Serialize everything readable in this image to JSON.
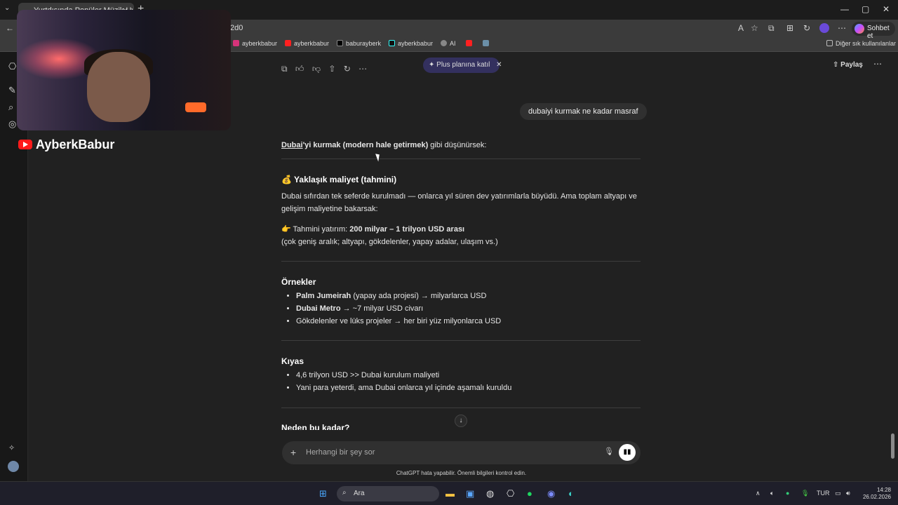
{
  "browser": {
    "tab_title": "Yurtdışında Popüler Müzik Uygula",
    "url": "2d0",
    "sohbet_label": "Sohbet et",
    "bookmarks": [
      "ayberkbabur",
      "ayberkbabur",
      "baburayberk",
      "ayberkbabur",
      "AI"
    ],
    "other_favorites": "Diğer sık kullanılanlar"
  },
  "channel": {
    "name": "AyberkBabur"
  },
  "chat": {
    "plus_banner": "✦ Plus planına katıl",
    "share_label": "Paylaş",
    "user_message": "dubaiyi kurmak ne kadar masraf",
    "intro_link": "Dubai",
    "intro_bold": "'yi kurmak (modern hale getirmek)",
    "intro_rest": " gibi düşünürsek:",
    "cost_heading": "💰 Yaklaşık maliyet (tahmini)",
    "cost_text": "Dubai sıfırdan tek seferde kurulmadı — onlarca yıl süren dev yatırımlarla büyüdü. Ama toplam altyapı ve gelişim maliyetine bakarsak:",
    "estimate_prefix": "👉 Tahmini yatırım: ",
    "estimate_value": "200 milyar – 1 trilyon USD arası",
    "estimate_note": "(çok geniş aralık; altyapı, gökdelenler, yapay adalar, ulaşım vs.)",
    "examples_heading": "Örnekler",
    "examples": [
      {
        "bold": "Palm Jumeirah",
        "rest": " (yapay ada projesi) → milyarlarca USD"
      },
      {
        "bold": "Dubai Metro",
        "rest": " → ~7 milyar USD civarı"
      },
      {
        "bold": "",
        "rest": "Gökdelenler ve lüks projeler → her biri yüz milyonlarca USD"
      }
    ],
    "compare_heading": "Kıyas",
    "compare": [
      "4,6 trilyon USD >> Dubai kurulum maliyeti",
      "Yani para yeterdi, ama Dubai onlarca yıl içinde aşamalı kuruldu"
    ],
    "next_heading": "Neden bu kadar?",
    "composer_placeholder": "Herhangi bir şey sor",
    "footer": "ChatGPT hata yapabilir. Önemli bilgileri kontrol edin."
  },
  "taskbar": {
    "search": "Ara",
    "lang": "TUR",
    "time": "14:28",
    "date": "26.02.2026"
  }
}
